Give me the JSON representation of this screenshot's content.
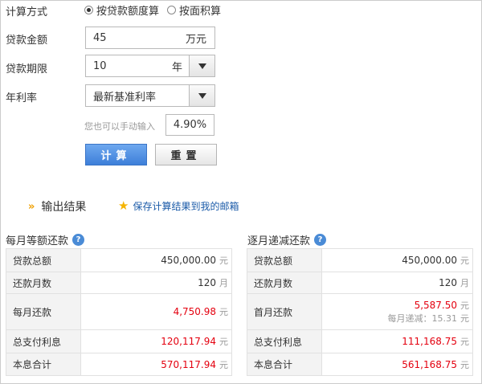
{
  "method": {
    "label": "计算方式",
    "options": [
      {
        "label": "按贷款额度算",
        "selected": true
      },
      {
        "label": "按面积算",
        "selected": false
      }
    ]
  },
  "amount": {
    "label": "贷款金额",
    "value": "45",
    "unit": "万元"
  },
  "term": {
    "label": "贷款期限",
    "value": "10",
    "unit": "年"
  },
  "rate": {
    "label": "年利率",
    "value": "最新基准利率",
    "hint": "您也可以手动输入",
    "manual": "4.90%"
  },
  "buttons": {
    "calc": "计算",
    "reset": "重置"
  },
  "output": {
    "title": "输出结果",
    "save": "保存计算结果到我的邮箱"
  },
  "equal_payment": {
    "title": "每月等额还款",
    "help": "?",
    "rows": [
      {
        "key": "贷款总额",
        "value": "450,000.00",
        "unit": "元"
      },
      {
        "key": "还款月数",
        "value": "120",
        "unit": "月"
      },
      {
        "key": "每月还款",
        "value": "4,750.98",
        "unit": "元"
      },
      {
        "key": "总支付利息",
        "value": "120,117.94",
        "unit": "元"
      },
      {
        "key": "本息合计",
        "value": "570,117.94",
        "unit": "元"
      }
    ]
  },
  "decreasing_payment": {
    "title": "逐月递减还款",
    "help": "?",
    "rows": [
      {
        "key": "贷款总额",
        "value": "450,000.00",
        "unit": "元"
      },
      {
        "key": "还款月数",
        "value": "120",
        "unit": "月"
      },
      {
        "key": "首月还款",
        "value": "5,587.50",
        "unit": "元",
        "sub": "每月递减：15.31",
        "sub_unit": "元"
      },
      {
        "key": "总支付利息",
        "value": "111,168.75",
        "unit": "元"
      },
      {
        "key": "本息合计",
        "value": "561,168.75",
        "unit": "元"
      }
    ]
  },
  "colors": {
    "accent": "#3d7fd9",
    "highlight": "#e4000f",
    "link": "#1a5aa8"
  }
}
